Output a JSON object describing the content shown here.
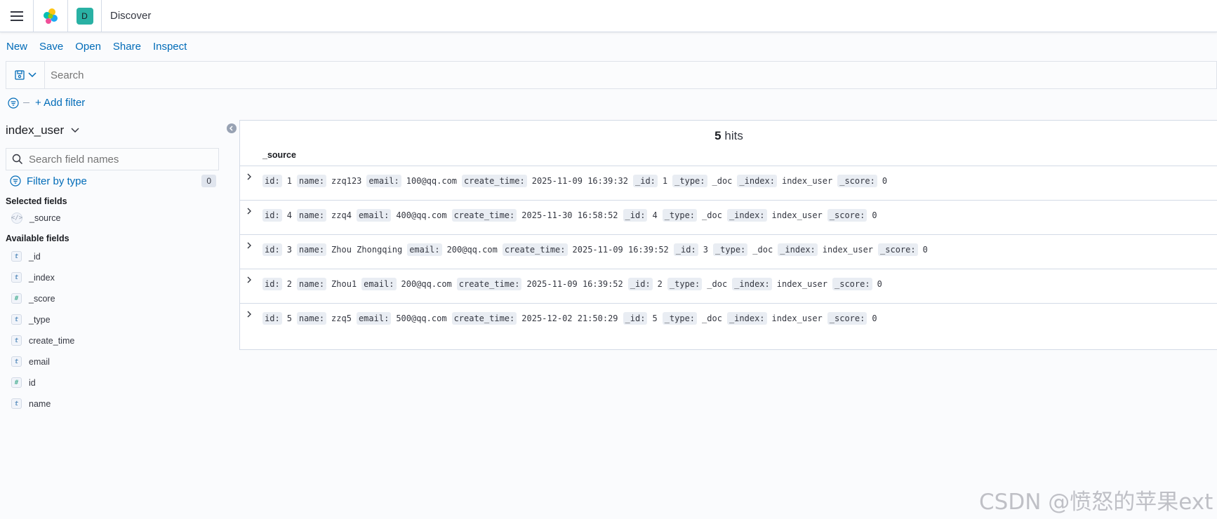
{
  "header": {
    "space_initial": "D",
    "page_title": "Discover"
  },
  "topnav": [
    "New",
    "Save",
    "Open",
    "Share",
    "Inspect"
  ],
  "querybar": {
    "placeholder": "Search"
  },
  "filter": {
    "add_label": "+ Add filter"
  },
  "sidebar": {
    "index_pattern": "index_user",
    "search_placeholder": "Search field names",
    "filter_by_type": "Filter by type",
    "filter_count": "0",
    "selected_title": "Selected fields",
    "selected_fields": [
      {
        "name": "_source",
        "type": "source"
      }
    ],
    "available_title": "Available fields",
    "available_fields": [
      {
        "name": "_id",
        "type": "t"
      },
      {
        "name": "_index",
        "type": "t"
      },
      {
        "name": "_score",
        "type": "#"
      },
      {
        "name": "_type",
        "type": "t"
      },
      {
        "name": "create_time",
        "type": "t"
      },
      {
        "name": "email",
        "type": "t"
      },
      {
        "name": "id",
        "type": "#"
      },
      {
        "name": "name",
        "type": "t"
      }
    ]
  },
  "results": {
    "hits_count": "5",
    "hits_label": "hits",
    "column": "_source",
    "documents": [
      [
        [
          "id:",
          "1"
        ],
        [
          "name:",
          "zzq123"
        ],
        [
          "email:",
          "100@qq.com"
        ],
        [
          "create_time:",
          "2025-11-09 16:39:32"
        ],
        [
          "_id:",
          "1"
        ],
        [
          "_type:",
          "_doc"
        ],
        [
          "_index:",
          "index_user"
        ],
        [
          "_score:",
          "0"
        ]
      ],
      [
        [
          "id:",
          "4"
        ],
        [
          "name:",
          "zzq4"
        ],
        [
          "email:",
          "400@qq.com"
        ],
        [
          "create_time:",
          "2025-11-30 16:58:52"
        ],
        [
          "_id:",
          "4"
        ],
        [
          "_type:",
          "_doc"
        ],
        [
          "_index:",
          "index_user"
        ],
        [
          "_score:",
          "0"
        ]
      ],
      [
        [
          "id:",
          "3"
        ],
        [
          "name:",
          "Zhou Zhongqing"
        ],
        [
          "email:",
          "200@qq.com"
        ],
        [
          "create_time:",
          "2025-11-09 16:39:52"
        ],
        [
          "_id:",
          "3"
        ],
        [
          "_type:",
          "_doc"
        ],
        [
          "_index:",
          "index_user"
        ],
        [
          "_score:",
          "0"
        ]
      ],
      [
        [
          "id:",
          "2"
        ],
        [
          "name:",
          "Zhou1"
        ],
        [
          "email:",
          "200@qq.com"
        ],
        [
          "create_time:",
          "2025-11-09 16:39:52"
        ],
        [
          "_id:",
          "2"
        ],
        [
          "_type:",
          "_doc"
        ],
        [
          "_index:",
          "index_user"
        ],
        [
          "_score:",
          "0"
        ]
      ],
      [
        [
          "id:",
          "5"
        ],
        [
          "name:",
          "zzq5"
        ],
        [
          "email:",
          "500@qq.com"
        ],
        [
          "create_time:",
          "2025-12-02 21:50:29"
        ],
        [
          "_id:",
          "5"
        ],
        [
          "_type:",
          "_doc"
        ],
        [
          "_index:",
          "index_user"
        ],
        [
          "_score:",
          "0"
        ]
      ]
    ]
  },
  "watermark": "CSDN @愤怒的苹果ext",
  "colors": {
    "link": "#006bb8",
    "space_badge": "#29b1a4",
    "border": "#d3dae6"
  },
  "icons": [
    "menu-icon",
    "elastic-logo-icon",
    "saved-query-icon",
    "chevron-down-icon",
    "filter-icon",
    "search-icon",
    "collapse-icon",
    "expand-row-icon"
  ]
}
